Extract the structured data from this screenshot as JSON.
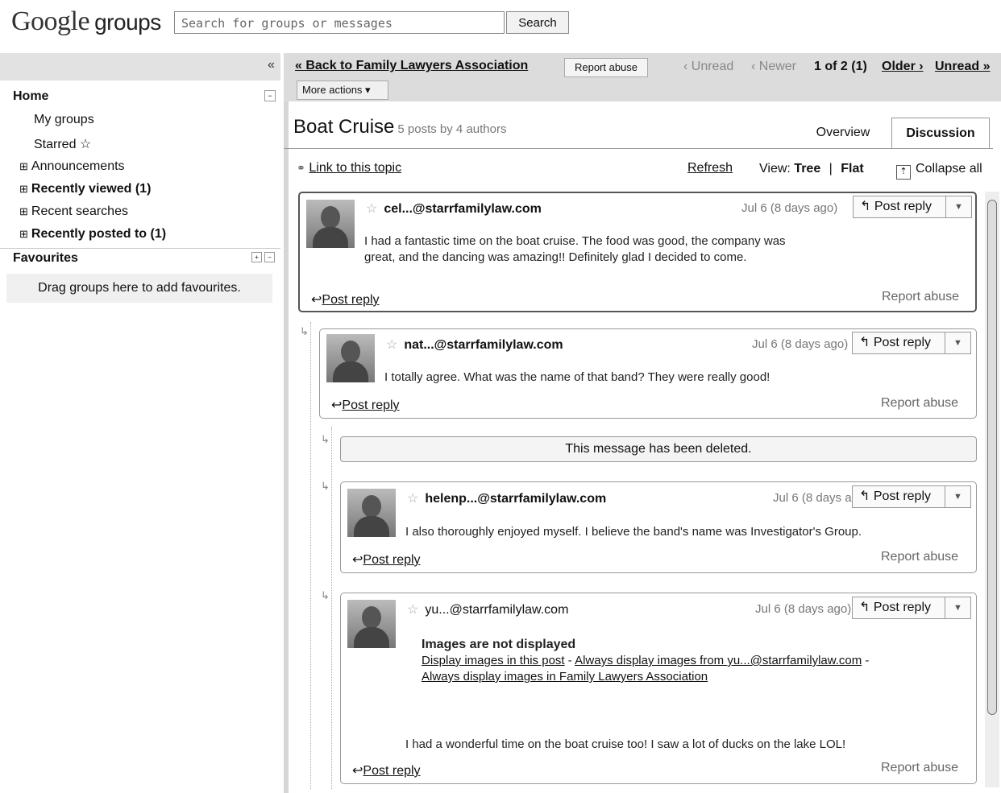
{
  "header": {
    "logo_google": "Google",
    "logo_groups": "groups",
    "search_placeholder": "Search for groups or messages",
    "search_button": "Search"
  },
  "sidebar": {
    "collapse_glyph": "«",
    "home": "Home",
    "home_toggle": "−",
    "items": [
      {
        "label": "My groups"
      },
      {
        "label": "Starred ☆"
      },
      {
        "label": "Announcements",
        "bold": false
      },
      {
        "label": "Recently viewed (1)",
        "bold": true
      },
      {
        "label": "Recent searches",
        "bold": false
      },
      {
        "label": "Recently posted to (1)",
        "bold": true
      }
    ],
    "expand_glyph": "⊞",
    "favourites": "Favourites",
    "favourites_hint": "Drag groups here to add favourites."
  },
  "toolbar": {
    "back_link": "« Back to Family Lawyers Association",
    "report_abuse": "Report abuse",
    "unread_prev": "‹ Unread",
    "newer": "‹ Newer",
    "position": "1 of 2 (1)",
    "older": "Older ›",
    "unread_next": "Unread »",
    "more_actions": "More actions ▾"
  },
  "topic": {
    "title": "Boat Cruise",
    "meta": "5 posts by 4 authors",
    "tabs": [
      "Overview",
      "Discussion"
    ],
    "link_to_topic": "Link to this topic",
    "refresh": "Refresh",
    "view_label": "View:",
    "view_tree": "Tree",
    "view_sep": "|",
    "view_flat": "Flat",
    "collapse_all": "Collapse all"
  },
  "posts": [
    {
      "author": "cel...@starrfamilylaw.com",
      "date": "Jul 6 (8 days ago)",
      "body": "I had a fantastic time on the boat cruise. The food was good, the company was great, and the dancing was amazing!! Definitely glad I decided to come."
    },
    {
      "author": "nat...@starrfamilylaw.com",
      "date": "Jul 6 (8 days ago)",
      "body": "I totally agree.  What was the name of that band? They were really good!"
    },
    {
      "deleted": "This message has been deleted."
    },
    {
      "author": "helenp...@starrfamilylaw.com",
      "date": "Jul 6 (8 days ago)",
      "body": "I also thoroughly enjoyed myself. I believe the band's name was Investigator's Group."
    },
    {
      "author": "yu...@starrfamilylaw.com",
      "date": "Jul 6 (8 days ago)",
      "images_title": "Images are not displayed",
      "images_link1": "Display images in this post",
      "images_sep1": " - ",
      "images_link2": "Always display images from yu...@starrfamilylaw.com",
      "images_sep2": " -",
      "images_link3": "Always display images in Family Lawyers Association",
      "body": "I had a wonderful time on the boat cruise too!  I saw a lot of ducks on the lake LOL!"
    }
  ],
  "common": {
    "post_reply": "Post reply",
    "post_reply_icon": "↰",
    "report_abuse": "Report abuse",
    "dropdown_glyph": "▼",
    "star_glyph": "☆",
    "thread_glyph": "↳"
  }
}
